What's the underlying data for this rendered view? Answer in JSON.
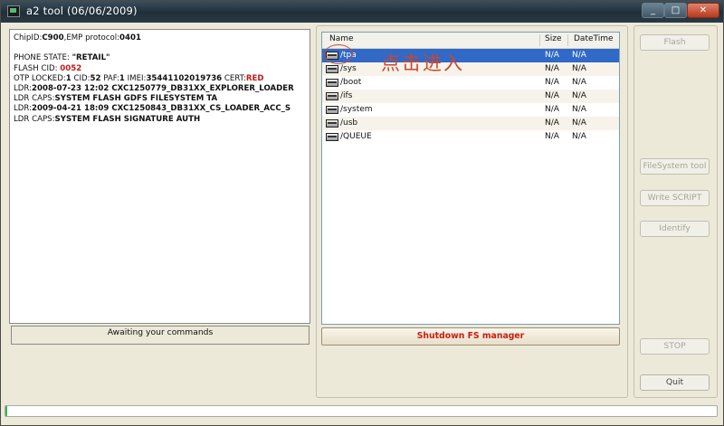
{
  "window": {
    "title": "a2 tool (06/06/2009)",
    "min": "_",
    "max": "□",
    "close": "✕"
  },
  "log": {
    "lines": [
      [
        {
          "t": "ChipID:"
        },
        {
          "t": "C900",
          "b": true
        },
        {
          "t": ",EMP protocol:"
        },
        {
          "t": "0401",
          "b": true
        }
      ],
      [
        {
          "t": ""
        }
      ],
      [
        {
          "t": "PHONE STATE: "
        },
        {
          "t": "\"RETAIL\"",
          "b": true
        }
      ],
      [
        {
          "t": "FLASH CID: "
        },
        {
          "t": "0052",
          "r": true
        }
      ],
      [
        {
          "t": "OTP LOCKED:"
        },
        {
          "t": "1",
          "b": true
        },
        {
          "t": " CID:"
        },
        {
          "t": "52",
          "b": true
        },
        {
          "t": " PAF:"
        },
        {
          "t": "1",
          "b": true
        },
        {
          "t": " IMEI:"
        },
        {
          "t": "35441102019736",
          "b": true
        },
        {
          "t": " CERT:"
        },
        {
          "t": "RED",
          "r": true
        }
      ],
      [
        {
          "t": "LDR:"
        },
        {
          "t": "2008-07-23 12:02 CXC1250779_DB31XX_EXPLORER_LOADER",
          "b": true
        }
      ],
      [
        {
          "t": "LDR CAPS:"
        },
        {
          "t": "SYSTEM FLASH GDFS FILESYSTEM TA",
          "b": true
        }
      ],
      [
        {
          "t": "LDR:"
        },
        {
          "t": "2009-04-21 18:09 CXC1250843_DB31XX_CS_LOADER_ACC_S",
          "b": true
        }
      ],
      [
        {
          "t": "LDR CAPS:"
        },
        {
          "t": "SYSTEM FLASH SIGNATURE AUTH",
          "b": true
        }
      ]
    ],
    "status": "Awaiting your commands"
  },
  "filelist": {
    "columns": {
      "name": "Name",
      "size": "Size",
      "datetime": "DateTime"
    },
    "rows": [
      {
        "name": "/tpa",
        "size": "N/A",
        "datetime": "N/A",
        "selected": true
      },
      {
        "name": "/sys",
        "size": "N/A",
        "datetime": "N/A"
      },
      {
        "name": "/boot",
        "size": "N/A",
        "datetime": "N/A"
      },
      {
        "name": "/ifs",
        "size": "N/A",
        "datetime": "N/A"
      },
      {
        "name": "/system",
        "size": "N/A",
        "datetime": "N/A"
      },
      {
        "name": "/usb",
        "size": "N/A",
        "datetime": "N/A"
      },
      {
        "name": "/QUEUE",
        "size": "N/A",
        "datetime": "N/A"
      }
    ],
    "annotation": "点击进入"
  },
  "buttons": {
    "shutdown": "Shutdown FS manager",
    "flash": "Flash",
    "filesystem": "FileSystem tool",
    "write_script": "Write SCRIPT",
    "identify": "Identify",
    "stop": "STOP",
    "quit": "Quit"
  },
  "progress": {
    "value": 0.003
  },
  "colors": {
    "accent_selection": "#3169c6",
    "warning_red": "#c01b1b",
    "progress_green": "#35b84a"
  }
}
